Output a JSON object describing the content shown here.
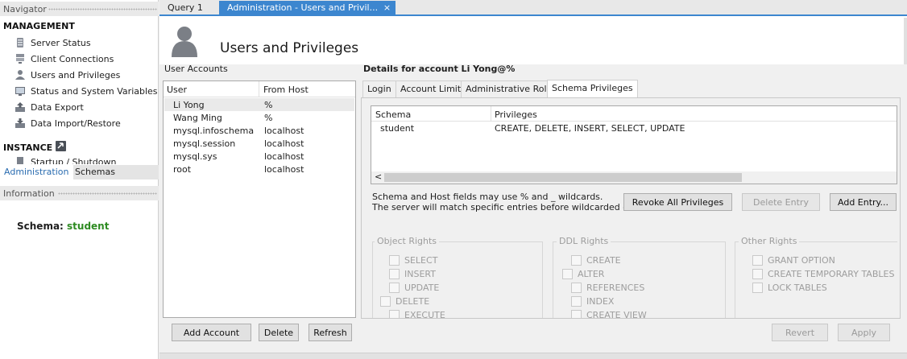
{
  "navigator": {
    "title": "Navigator",
    "management_title": "MANAGEMENT",
    "management_items": [
      {
        "label": "Server Status",
        "icon": "server-status-icon"
      },
      {
        "label": "Client Connections",
        "icon": "client-connections-icon"
      },
      {
        "label": "Users and Privileges",
        "icon": "users-icon"
      },
      {
        "label": "Status and System Variables",
        "icon": "variables-icon"
      },
      {
        "label": "Data Export",
        "icon": "export-icon"
      },
      {
        "label": "Data Import/Restore",
        "icon": "import-icon"
      }
    ],
    "instance_title": "INSTANCE",
    "instance_items": [
      {
        "label": "Startup / Shutdown",
        "icon": "startup-icon"
      }
    ],
    "subtabs": [
      "Administration",
      "Schemas"
    ],
    "information_title": "Information",
    "schema_label": "Schema:",
    "schema_value": "student"
  },
  "doc_tabs": [
    {
      "label": "Query 1",
      "active": false
    },
    {
      "label": "Administration - Users and Privil...",
      "active": true
    }
  ],
  "page": {
    "title": "Users and Privileges"
  },
  "accounts": {
    "title": "User Accounts",
    "columns": [
      "User",
      "From Host"
    ],
    "rows": [
      {
        "user": "Li Yong",
        "host": "%",
        "selected": true
      },
      {
        "user": "Wang Ming",
        "host": "%"
      },
      {
        "user": "mysql.infoschema",
        "host": "localhost"
      },
      {
        "user": "mysql.session",
        "host": "localhost"
      },
      {
        "user": "mysql.sys",
        "host": "localhost"
      },
      {
        "user": "root",
        "host": "localhost"
      }
    ],
    "buttons": {
      "add": "Add Account",
      "delete": "Delete",
      "refresh": "Refresh"
    }
  },
  "details": {
    "title": "Details for account Li Yong@%",
    "tabs": [
      "Login",
      "Account Limits",
      "Administrative Roles",
      "Schema Privileges"
    ],
    "active_tab": "Schema Privileges",
    "columns": [
      "Schema",
      "Privileges"
    ],
    "rows": [
      {
        "schema": "student",
        "privileges": "CREATE, DELETE, INSERT, SELECT, UPDATE"
      }
    ],
    "hint_line1": "Schema and Host fields may use % and _ wildcards.",
    "hint_line2": "The server will match specific entries before wildcarded ones.",
    "revoke_all": "Revoke All Privileges",
    "delete_entry": "Delete Entry",
    "add_entry": "Add Entry...",
    "object_rights": {
      "title": "Object Rights",
      "items": [
        "SELECT",
        "INSERT",
        "UPDATE",
        "DELETE",
        "EXECUTE"
      ]
    },
    "ddl_rights": {
      "title": "DDL Rights",
      "items": [
        "CREATE",
        "ALTER",
        "REFERENCES",
        "INDEX",
        "CREATE VIEW"
      ]
    },
    "other_rights": {
      "title": "Other Rights",
      "items": [
        "GRANT OPTION",
        "CREATE TEMPORARY TABLES",
        "LOCK TABLES"
      ]
    },
    "revert": "Revert",
    "apply": "Apply"
  },
  "colors": {
    "accent": "#3c86cf",
    "schema_value": "#2e8b22"
  }
}
